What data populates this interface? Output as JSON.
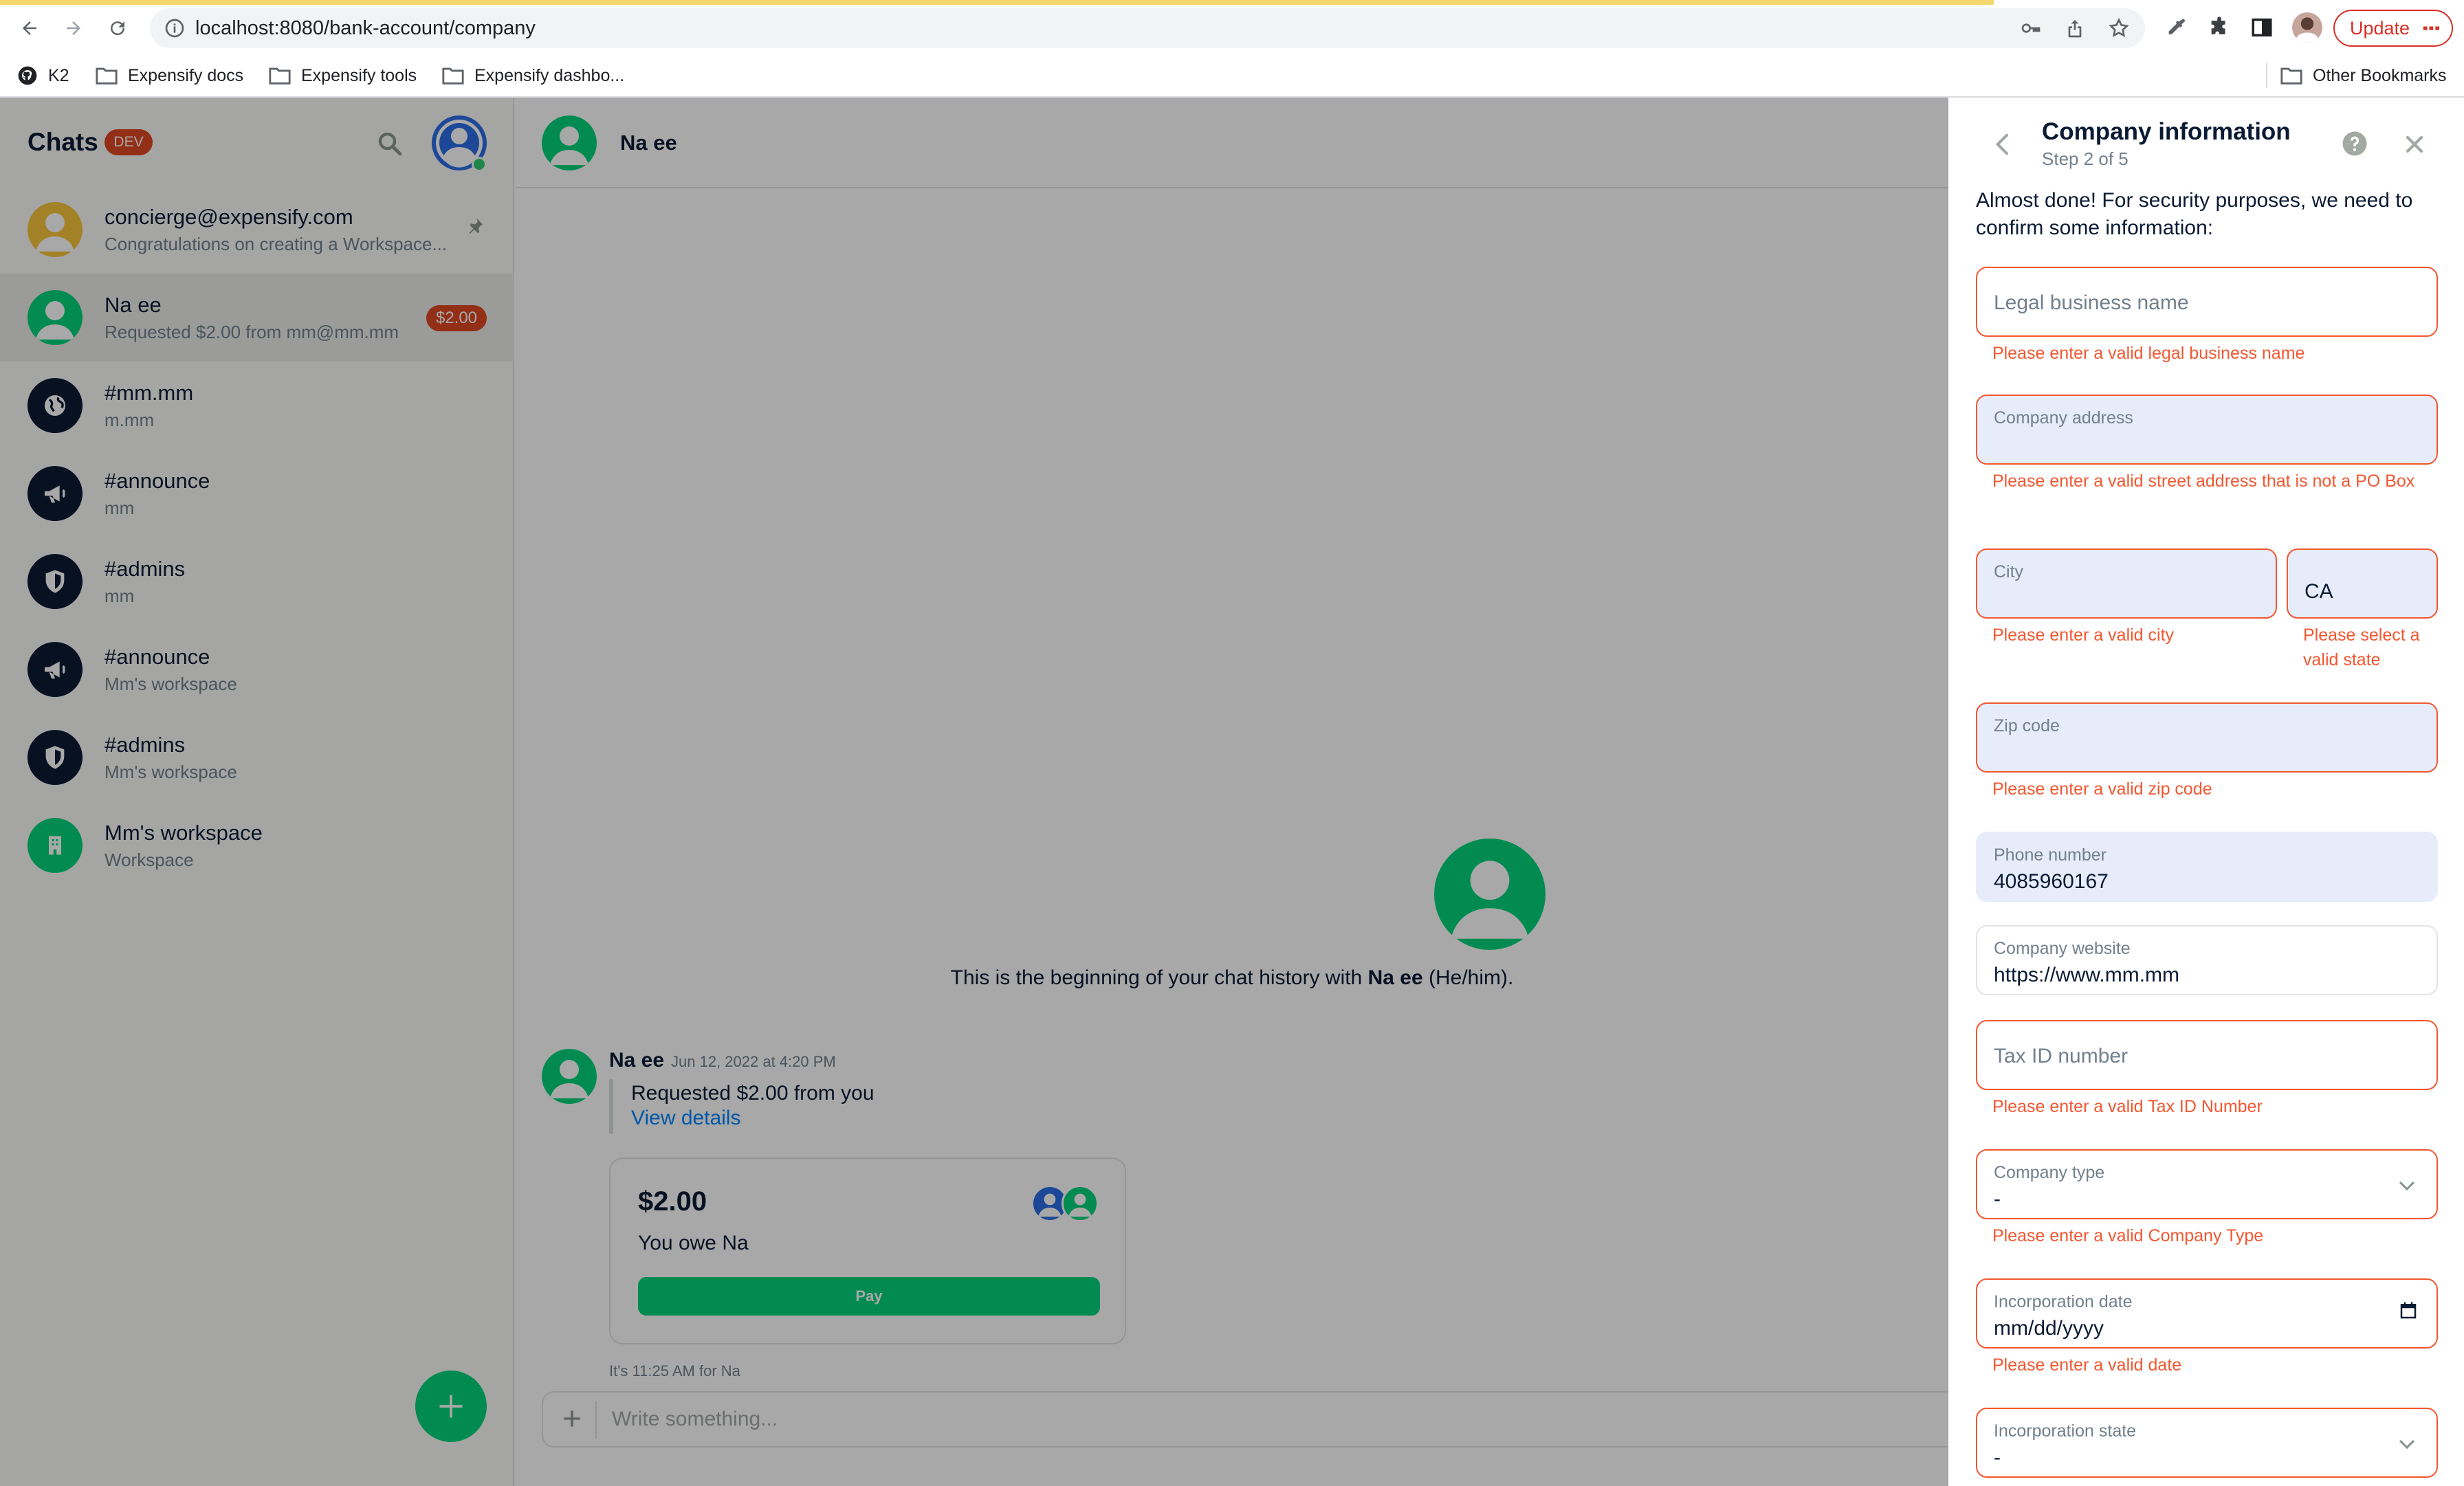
{
  "browser": {
    "url": "localhost:8080/bank-account/company",
    "update_label": "Update",
    "bookmarks": [
      "K2",
      "Expensify docs",
      "Expensify tools",
      "Expensify dashbo...",
      "Other Bookmarks"
    ]
  },
  "sidebar": {
    "title": "Chats",
    "badge": "DEV",
    "chats": [
      {
        "name": "concierge@expensify.com",
        "subtitle": "Congratulations on creating a Workspace...",
        "avatar_color": "#f8c43c"
      },
      {
        "name": "Na ee",
        "subtitle": "Requested $2.00 from mm@mm.mm",
        "badge": "$2.00",
        "avatar_color": "#03d47c"
      },
      {
        "name": "#mm.mm",
        "subtitle": "m.mm",
        "icon": "globe-icon"
      },
      {
        "name": "#announce",
        "subtitle": "mm",
        "icon": "megaphone-icon"
      },
      {
        "name": "#admins",
        "subtitle": "mm",
        "icon": "shield-icon"
      },
      {
        "name": "#announce",
        "subtitle": "Mm's workspace",
        "icon": "megaphone-icon"
      },
      {
        "name": "#admins",
        "subtitle": "Mm's workspace",
        "icon": "shield-icon"
      },
      {
        "name": "Mm's workspace",
        "subtitle": "Workspace",
        "icon": "building-icon",
        "avatar_color": "#03d47c"
      }
    ]
  },
  "chat": {
    "header_name": "Na ee",
    "welcome_prefix": "This is the beginning of your chat history with ",
    "welcome_name": "Na ee",
    "welcome_suffix": " (He/him).",
    "message": {
      "author": "Na ee",
      "time": "Jun 12, 2022 at 4:20 PM",
      "text": "Requested $2.00 from you",
      "link": "View details"
    },
    "iou": {
      "amount": "$2.00",
      "description": "You owe Na",
      "pay_label": "Pay"
    },
    "local_time": "It's 11:25 AM for Na",
    "composer_placeholder": "Write something..."
  },
  "panel": {
    "title": "Company information",
    "step": "Step 2 of 5",
    "intro": "Almost done! For security purposes, we need to confirm some information:",
    "fields": {
      "legal_name": {
        "label": "Legal business name",
        "error": "Please enter a valid legal business name"
      },
      "address": {
        "label": "Company address",
        "error": "Please enter a valid street address that is not a PO Box"
      },
      "city": {
        "label": "City",
        "error": "Please enter a valid city"
      },
      "state": {
        "value": "CA",
        "error": "Please select a valid state"
      },
      "zip": {
        "label": "Zip code",
        "error": "Please enter a valid zip code"
      },
      "phone": {
        "label": "Phone number",
        "value": "4085960167"
      },
      "website": {
        "label": "Company website",
        "value": "https://www.mm.mm"
      },
      "tax_id": {
        "label": "Tax ID number",
        "error": "Please enter a valid Tax ID Number"
      },
      "company_type": {
        "label": "Company type",
        "value": "-",
        "error": "Please enter a valid Company Type"
      },
      "incorporation_date": {
        "label": "Incorporation date",
        "value": "mm/dd/yyyy",
        "error": "Please enter a valid date"
      },
      "incorporation_state": {
        "label": "Incorporation state",
        "value": "-"
      }
    }
  }
}
